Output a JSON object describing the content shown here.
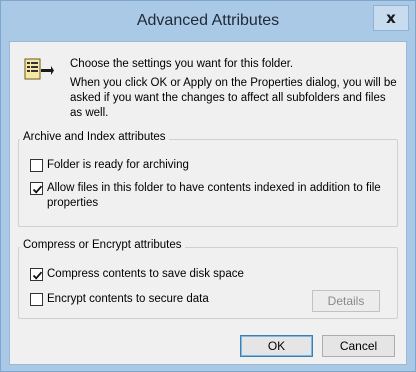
{
  "window": {
    "title": "Advanced Attributes",
    "close_glyph": "x"
  },
  "intro": {
    "line1": "Choose the settings you want for this folder.",
    "line2": "When you click OK or Apply on the Properties dialog, you will be asked if you want the changes to affect all subfolders and files as well."
  },
  "archive_group": {
    "title": "Archive and Index attributes",
    "archiving": {
      "label": "Folder is ready for archiving",
      "checked": false
    },
    "indexing": {
      "label": "Allow files in this folder to have contents indexed in addition to file properties",
      "checked": true
    }
  },
  "compress_group": {
    "title": "Compress or Encrypt attributes",
    "compress": {
      "label": "Compress contents to save disk space",
      "checked": true
    },
    "encrypt": {
      "label": "Encrypt contents to secure data",
      "checked": false
    },
    "details_label": "Details"
  },
  "buttons": {
    "ok": "OK",
    "cancel": "Cancel"
  },
  "icons": {
    "folder_settings": "folder-settings-icon",
    "checkmark": "checkmark-icon"
  },
  "colors": {
    "title_bg": "#a9c9e6",
    "client_bg": "#f0f0f0",
    "default_button_border": "#3c7fb1"
  }
}
